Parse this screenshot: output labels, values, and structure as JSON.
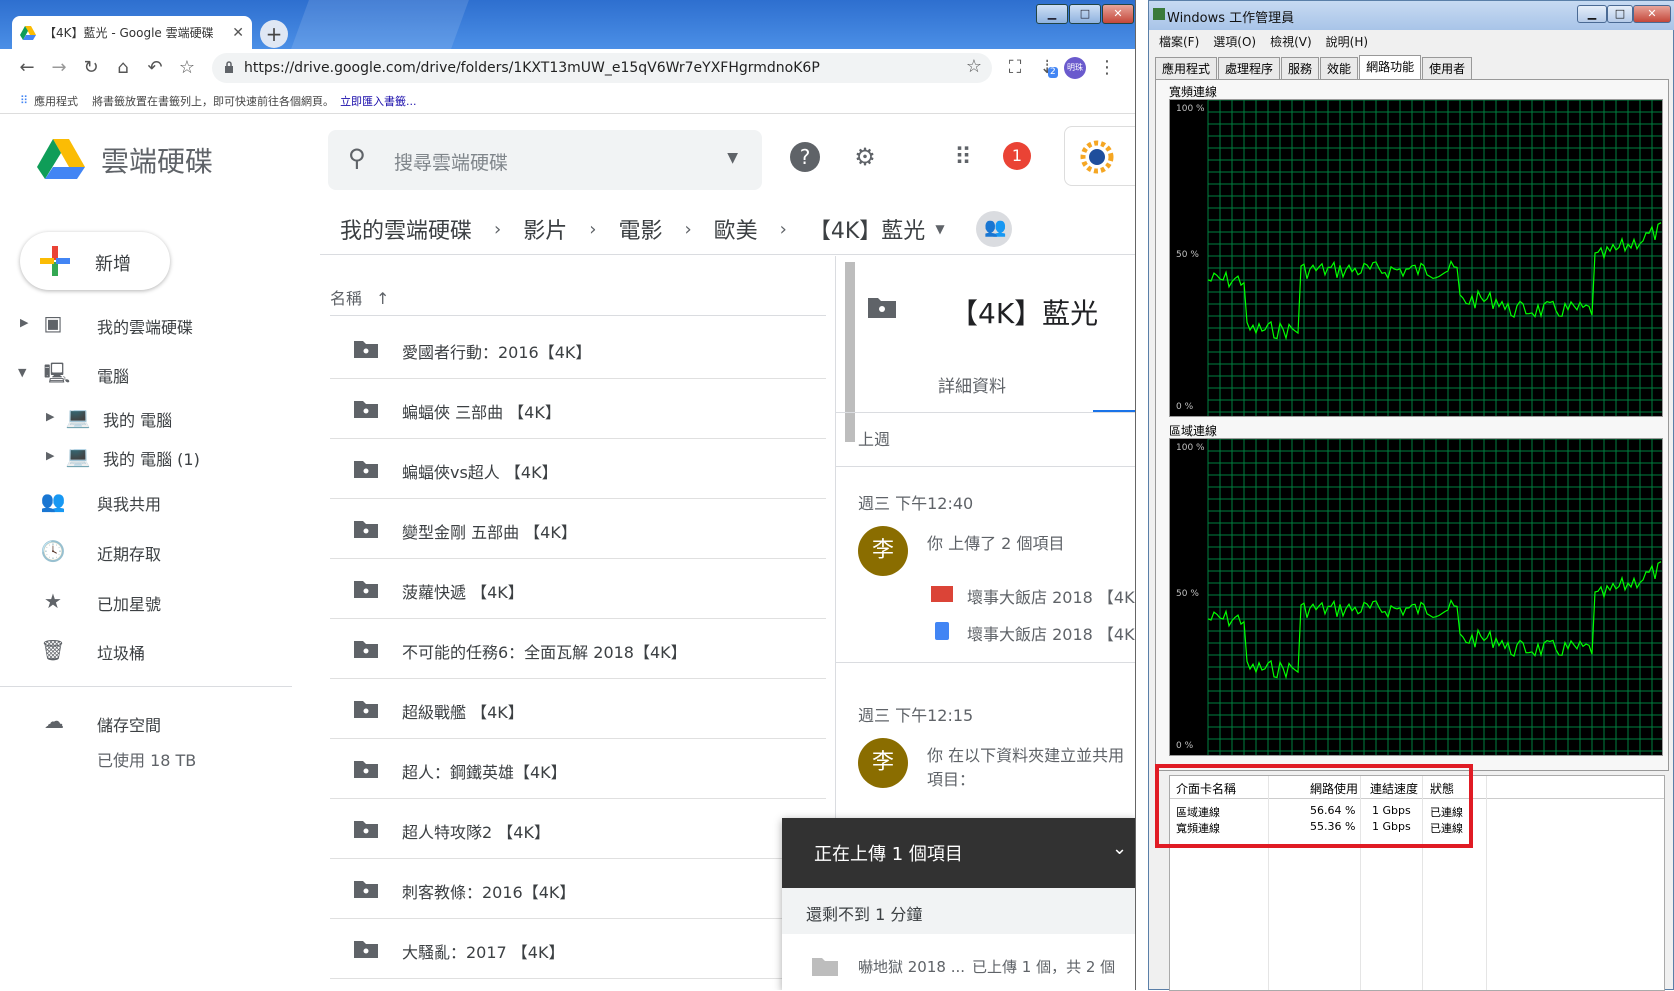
{
  "browser": {
    "tab_title": "【4K】藍光 - Google 雲端硬碟",
    "url": "https://drive.google.com/drive/folders/1KXT13mUW_e15qV6Wr7eYXFHgrmdnoK6P",
    "bookmarks_apps": "應用程式",
    "bookmarks_hint": "將書籤放置在書籤列上，即可快速前往各個網頁。",
    "bookmarks_import": "立即匯入書籤...",
    "extension_badge": "2",
    "profile_label": "明珠"
  },
  "drive": {
    "brand": "雲端硬碟",
    "search_placeholder": "搜尋雲端硬碟",
    "notification_count": "1",
    "breadcrumb": [
      "我的雲端硬碟",
      "影片",
      "電影",
      "歐美",
      "【4K】藍光"
    ],
    "new_button": "新增",
    "nav": {
      "my_drive": "我的雲端硬碟",
      "computers": "電腦",
      "computer1": "我的 電腦",
      "computer2": "我的 電腦 (1)",
      "shared": "與我共用",
      "recent": "近期存取",
      "starred": "已加星號",
      "trash": "垃圾桶",
      "storage": "儲存空間",
      "storage_used": "已使用 18 TB"
    },
    "file_header": "名稱",
    "files": [
      "愛國者行動：2016【4K】",
      "蝙蝠俠 三部曲 【4K】",
      "蝙蝠俠vs超人 【4K】",
      "變型金剛 五部曲 【4K】",
      "菠蘿快遞 【4K】",
      "不可能的任務6：全面瓦解 2018【4K】",
      "超級戰艦 【4K】",
      "超人：鋼鐵英雄【4K】",
      "超人特攻隊2 【4K】",
      "刺客教條：2016【4K】",
      "大騷亂：2017 【4K】"
    ],
    "details": {
      "title": "【4K】藍光",
      "tab": "詳細資料",
      "section1": "上週",
      "time1": "週三 下午12:40",
      "avatar": "李",
      "activity1": "你 上傳了 2 個項目",
      "item1": "壞事大飯店 2018 【4K",
      "item2": "壞事大飯店 2018 【4K",
      "time2": "週三 下午12:15",
      "activity2a": "你 在以下資料夾建立並共用",
      "activity2b": "項目："
    },
    "upload": {
      "header": "正在上傳 1 個項目",
      "remaining": "還剩不到 1 分鐘",
      "file": "嚇地獄 2018 ...",
      "status": "已上傳 1 個，共 2 個"
    }
  },
  "taskmgr": {
    "title": "Windows 工作管理員",
    "menu": [
      "檔案(F)",
      "選項(O)",
      "檢視(V)",
      "說明(H)"
    ],
    "tabs": [
      "應用程式",
      "處理程序",
      "服務",
      "效能",
      "網路功能",
      "使用者"
    ],
    "active_tab": "網路功能",
    "graph1_title": "寬頻連線",
    "graph2_title": "區域連線",
    "ylabels": [
      "100 %",
      "50 %",
      "0 %"
    ],
    "columns": [
      "介面卡名稱",
      "網路使用",
      "連結速度",
      "狀態"
    ],
    "rows": [
      {
        "name": "區域連線",
        "usage": "56.64 %",
        "speed": "1 Gbps",
        "state": "已連線"
      },
      {
        "name": "寬頻連線",
        "usage": "55.36 %",
        "speed": "1 Gbps",
        "state": "已連線"
      }
    ]
  },
  "colors": {
    "accent_blue": "#1a73e8",
    "graph_line": "#00ff00",
    "graph_grid": "#008040",
    "highlight_red": "#e01b24"
  }
}
